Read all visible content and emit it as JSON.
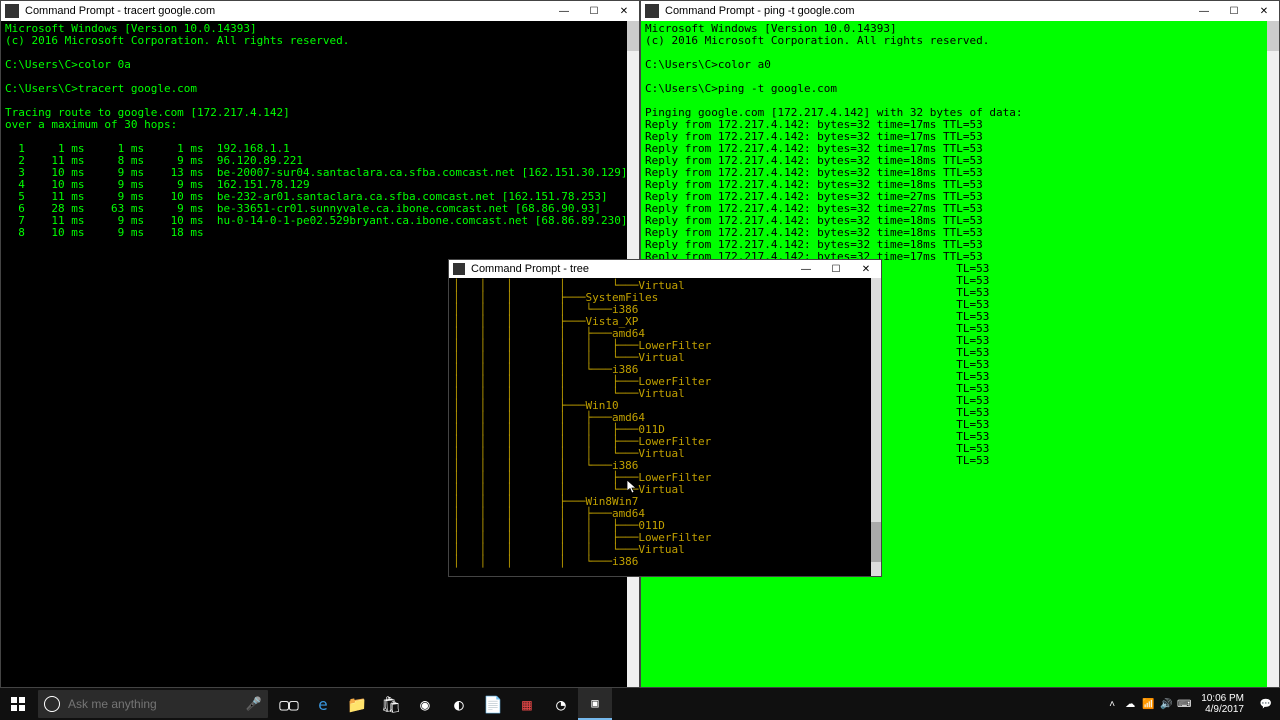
{
  "left_window": {
    "title": "Command Prompt - tracert  google.com",
    "lines": [
      "Microsoft Windows [Version 10.0.14393]",
      "(c) 2016 Microsoft Corporation. All rights reserved.",
      "",
      "C:\\Users\\C>color 0a",
      "",
      "C:\\Users\\C>tracert google.com",
      "",
      "Tracing route to google.com [172.217.4.142]",
      "over a maximum of 30 hops:",
      "",
      "  1     1 ms     1 ms     1 ms  192.168.1.1",
      "  2    11 ms     8 ms     9 ms  96.120.89.221",
      "  3    10 ms     9 ms    13 ms  be-20007-sur04.santaclara.ca.sfba.comcast.net [162.151.30.129]",
      "  4    10 ms     9 ms     9 ms  162.151.78.129",
      "  5    11 ms     9 ms    10 ms  be-232-ar01.santaclara.ca.sfba.comcast.net [162.151.78.253]",
      "  6    28 ms    63 ms     9 ms  be-33651-cr01.sunnyvale.ca.ibone.comcast.net [68.86.90.93]",
      "  7    11 ms     9 ms    10 ms  hu-0-14-0-1-pe02.529bryant.ca.ibone.comcast.net [68.86.89.230]",
      "  8    10 ms     9 ms    18 ms"
    ]
  },
  "right_window": {
    "title": "Command Prompt - ping  -t google.com",
    "lines": [
      "Microsoft Windows [Version 10.0.14393]",
      "(c) 2016 Microsoft Corporation. All rights reserved.",
      "",
      "C:\\Users\\C>color a0",
      "",
      "C:\\Users\\C>ping -t google.com",
      "",
      "Pinging google.com [172.217.4.142] with 32 bytes of data:",
      "Reply from 172.217.4.142: bytes=32 time=17ms TTL=53",
      "Reply from 172.217.4.142: bytes=32 time=17ms TTL=53",
      "Reply from 172.217.4.142: bytes=32 time=17ms TTL=53",
      "Reply from 172.217.4.142: bytes=32 time=18ms TTL=53",
      "Reply from 172.217.4.142: bytes=32 time=18ms TTL=53",
      "Reply from 172.217.4.142: bytes=32 time=18ms TTL=53",
      "Reply from 172.217.4.142: bytes=32 time=27ms TTL=53",
      "Reply from 172.217.4.142: bytes=32 time=27ms TTL=53",
      "Reply from 172.217.4.142: bytes=32 time=18ms TTL=53",
      "Reply from 172.217.4.142: bytes=32 time=18ms TTL=53",
      "Reply from 172.217.4.142: bytes=32 time=18ms TTL=53",
      "Reply from 172.217.4.142: bytes=32 time=17ms TTL=53",
      "                                               TL=53",
      "                                               TL=53",
      "                                               TL=53",
      "                                               TL=53",
      "                                               TL=53",
      "                                               TL=53",
      "                                               TL=53",
      "                                               TL=53",
      "                                               TL=53",
      "                                               TL=53",
      "                                               TL=53",
      "                                               TL=53",
      "                                               TL=53",
      "                                               TL=53",
      "                                               TL=53",
      "                                               TL=53",
      "                                               TL=53"
    ]
  },
  "tree_window": {
    "title": "Command Prompt - tree",
    "lines": [
      "│   │   │       │       └───Virtual",
      "│   │   │       ├───SystemFiles",
      "│   │   │       │   └───i386",
      "│   │   │       ├───Vista_XP",
      "│   │   │       │   ├───amd64",
      "│   │   │       │   │   ├───LowerFilter",
      "│   │   │       │   │   └───Virtual",
      "│   │   │       │   └───i386",
      "│   │   │       │       ├───LowerFilter",
      "│   │   │       │       └───Virtual",
      "│   │   │       ├───Win10",
      "│   │   │       │   ├───amd64",
      "│   │   │       │   │   ├───011D",
      "│   │   │       │   │   ├───LowerFilter",
      "│   │   │       │   │   └───Virtual",
      "│   │   │       │   └───i386",
      "│   │   │       │       ├───LowerFilter",
      "│   │   │       │       └───Virtual",
      "│   │   │       ├───Win8Win7",
      "│   │   │       │   ├───amd64",
      "│   │   │       │   │   ├───011D",
      "│   │   │       │   │   ├───LowerFilter",
      "│   │   │       │   │   └───Virtual",
      "│   │   │       │   └───i386"
    ]
  },
  "search": {
    "placeholder": "Ask me anything"
  },
  "clock": {
    "time": "10:06 PM",
    "date": "4/9/2017"
  },
  "btns": {
    "min": "—",
    "max": "☐",
    "close": "✕"
  }
}
